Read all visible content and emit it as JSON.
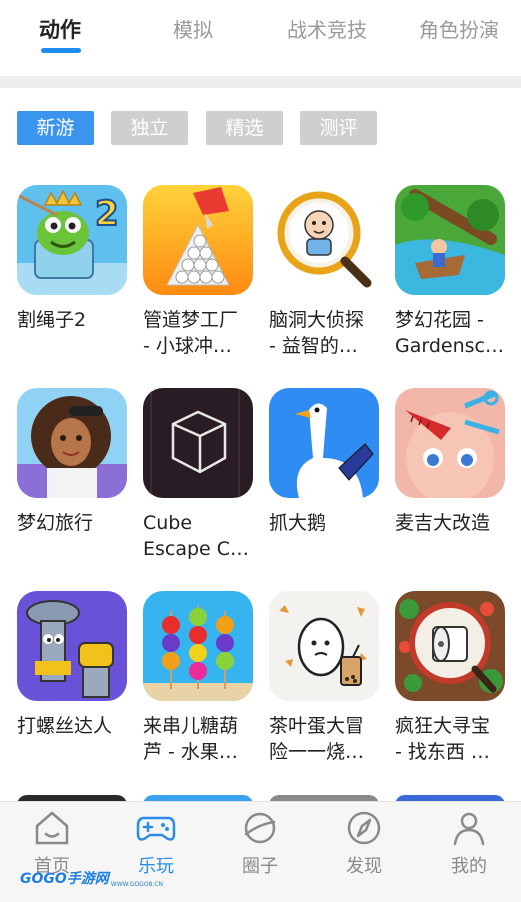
{
  "tabs": [
    {
      "label": "动作",
      "active": true
    },
    {
      "label": "模拟",
      "active": false
    },
    {
      "label": "战术竞技",
      "active": false
    },
    {
      "label": "角色扮演",
      "active": false
    }
  ],
  "chips": [
    {
      "label": "新游",
      "active": true
    },
    {
      "label": "独立",
      "active": false
    },
    {
      "label": "精选",
      "active": false
    },
    {
      "label": "测评",
      "active": false
    }
  ],
  "apps": [
    {
      "name": "割绳子2",
      "icon": "cut-the-rope-2-icon"
    },
    {
      "name": "管道梦工厂\n- 小球冲…",
      "icon": "pipe-balls-icon"
    },
    {
      "name": "脑洞大侦探\n- 益智的…",
      "icon": "magnifier-detective-icon"
    },
    {
      "name": "梦幻花园 -\nGardensc…",
      "icon": "garden-boat-icon"
    },
    {
      "name": "梦幻旅行",
      "icon": "travel-girl-icon"
    },
    {
      "name": "Cube\nEscape C…",
      "icon": "cube-escape-icon"
    },
    {
      "name": "抓大鹅",
      "icon": "goose-icon"
    },
    {
      "name": "麦吉大改造",
      "icon": "makeover-icon"
    },
    {
      "name": "打螺丝达人",
      "icon": "screw-master-icon"
    },
    {
      "name": "来串儿糖葫\n芦 - 水果…",
      "icon": "candied-fruit-icon"
    },
    {
      "name": "茶叶蛋大冒\n险一一烧…",
      "icon": "tea-egg-icon"
    },
    {
      "name": "疯狂大寻宝\n- 找东西 …",
      "icon": "treasure-hunt-icon"
    }
  ],
  "bottom_nav": [
    {
      "label": "首页",
      "icon": "home-icon",
      "active": false
    },
    {
      "label": "乐玩",
      "icon": "gamepad-icon",
      "active": true
    },
    {
      "label": "圈子",
      "icon": "planet-icon",
      "active": false
    },
    {
      "label": "发现",
      "icon": "compass-icon",
      "active": false
    },
    {
      "label": "我的",
      "icon": "person-icon",
      "active": false
    }
  ],
  "watermark": {
    "logo": "GOGO手游网",
    "url": "WWW.GOGO8.CN"
  },
  "colors": {
    "accent": "#2b8de8",
    "chip_active": "#3a95ee",
    "chip_inactive": "#cfcfcf"
  }
}
